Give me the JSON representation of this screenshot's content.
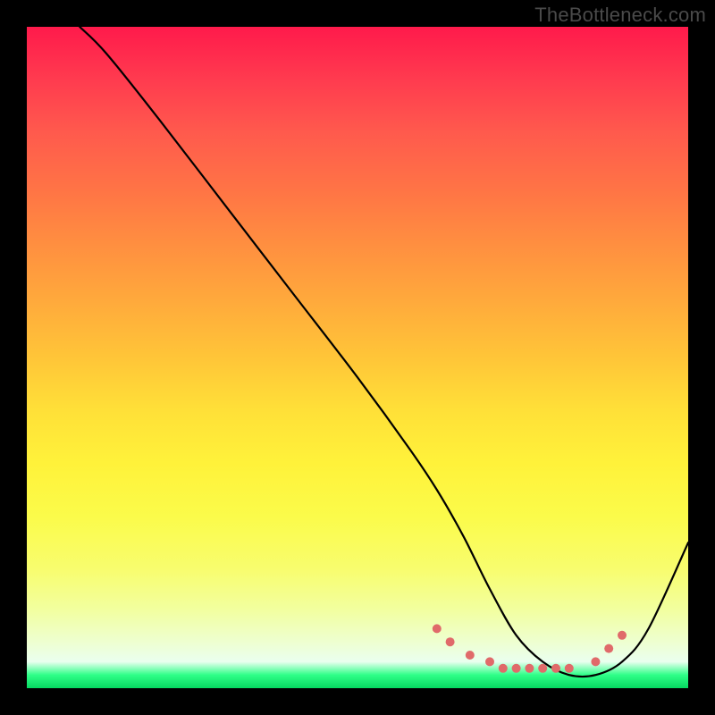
{
  "watermark": "TheBottleneck.com",
  "chart_data": {
    "type": "line",
    "title": "",
    "xlabel": "",
    "ylabel": "",
    "xlim": [
      0,
      100
    ],
    "ylim": [
      0,
      100
    ],
    "series": [
      {
        "name": "curve",
        "x": [
          8,
          12,
          20,
          30,
          40,
          50,
          58,
          62,
          66,
          70,
          74,
          78,
          82,
          86,
          90,
          94,
          100
        ],
        "values": [
          100,
          96,
          86,
          73,
          60,
          47,
          36,
          30,
          23,
          15,
          8,
          4,
          2,
          2,
          4,
          9,
          22
        ]
      }
    ],
    "markers": {
      "name": "dots",
      "color": "#e06a6a",
      "x": [
        62,
        64,
        67,
        70,
        72,
        74,
        76,
        78,
        80,
        82,
        86,
        88,
        90
      ],
      "values": [
        9,
        7,
        5,
        4,
        3,
        3,
        3,
        3,
        3,
        3,
        4,
        6,
        8
      ]
    }
  }
}
